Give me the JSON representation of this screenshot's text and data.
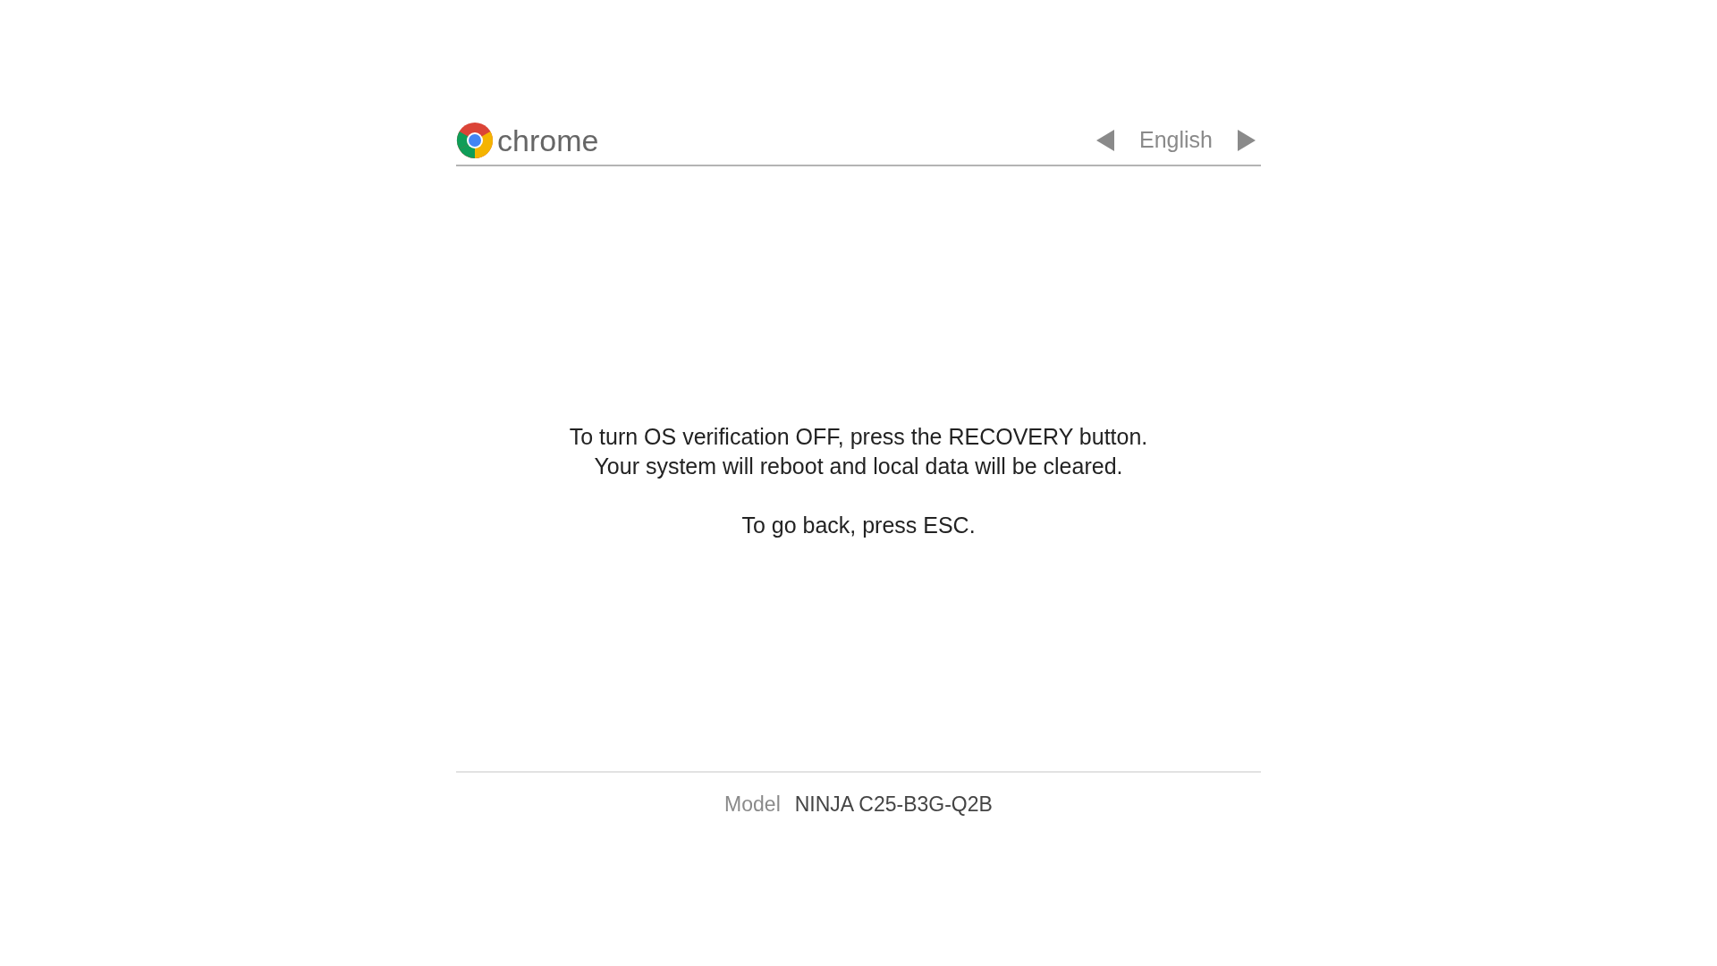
{
  "header": {
    "logo_text": "chrome",
    "language": "English"
  },
  "message": [
    {
      "lines": [
        "To turn OS verification OFF, press the RECOVERY button.",
        "Your system will reboot and local data will be cleared."
      ]
    },
    {
      "lines": [
        "To go back, press ESC."
      ]
    }
  ],
  "footer": {
    "label": "Model",
    "value": "NINJA C25-B3G-Q2B"
  }
}
